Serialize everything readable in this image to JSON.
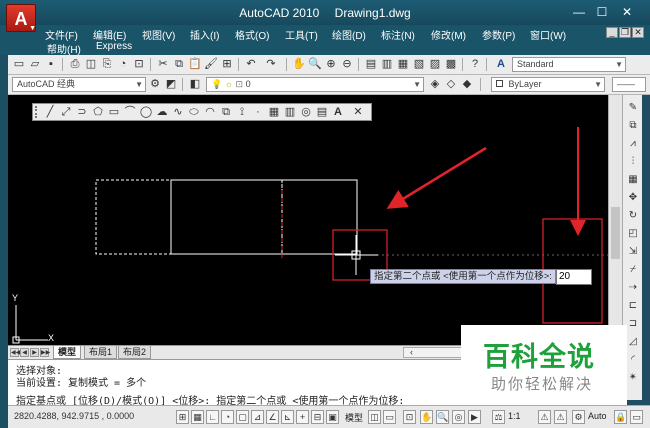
{
  "window": {
    "app_name": "AutoCAD 2010",
    "document": "Drawing1.dwg",
    "controls": [
      "—",
      "☐",
      "✕"
    ]
  },
  "menu": {
    "row1": [
      "文件(F)",
      "编辑(E)",
      "视图(V)",
      "插入(I)",
      "格式(O)",
      "工具(T)",
      "绘图(D)",
      "标注(N)",
      "修改(M)",
      "参数(P)",
      "窗口(W)"
    ],
    "row2": [
      "帮助(H)",
      "Express"
    ],
    "mdi_controls": [
      "_",
      "❐",
      "✕"
    ]
  },
  "toolbar_standard": {
    "text_style": "Standard"
  },
  "toolbar_layers": {
    "workspace": "AutoCAD 经典",
    "layer": "0",
    "color": "ByLayer"
  },
  "tabs": [
    "模型",
    "布局1",
    "布局2"
  ],
  "command": {
    "line1": "选择对象:",
    "line2": "当前设置:  复制模式 = 多个",
    "line3": "指定基点或 [位移(D)/模式(O)] <位移>: 指定第二个点或 <使用第一个点作为位移:"
  },
  "prompt": {
    "tooltip": "指定第二个点或 <使用第一个点作为位移>:",
    "input_value": "20"
  },
  "status": {
    "coords": "2820.4288, 942.9715 , 0.0000",
    "model_label": "模型",
    "scale": "1:1",
    "auto_label": "Auto"
  },
  "ucs": {
    "x_label": "X",
    "y_label": "Y"
  },
  "watermark": {
    "brand": "百科全说",
    "slogan": "助你轻松解决"
  },
  "colors": {
    "annotation_red": "#e0242a",
    "brand_green": "#1ea13a"
  }
}
